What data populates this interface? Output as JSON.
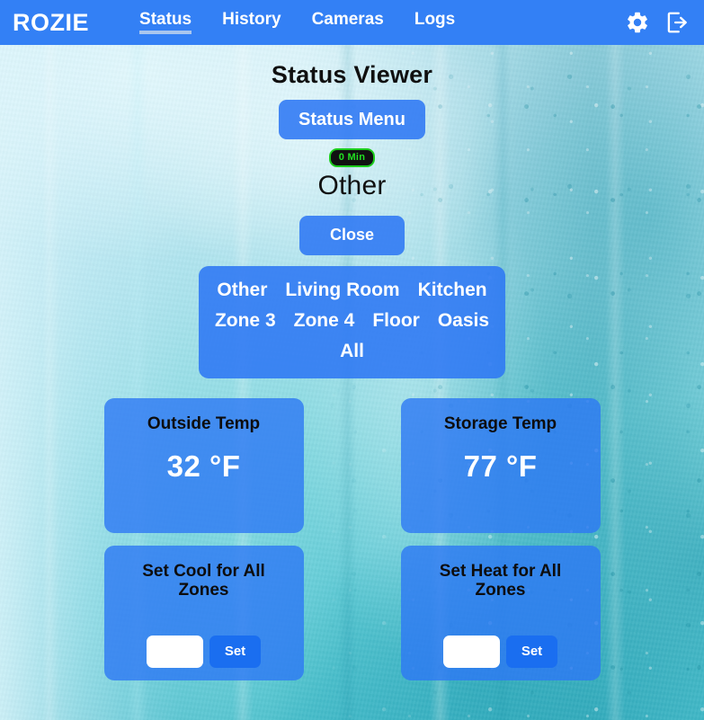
{
  "app": {
    "brand": "ROZIE",
    "header_color": "#3380f5",
    "accent_color": "#2d78f4",
    "active_tab_underline": "#a9c6ee"
  },
  "nav": {
    "links": [
      {
        "label": "Status",
        "active": true
      },
      {
        "label": "History",
        "active": false
      },
      {
        "label": "Cameras",
        "active": false
      },
      {
        "label": "Logs",
        "active": false
      }
    ],
    "actions": [
      {
        "icon": "gear-icon",
        "label": "Settings"
      },
      {
        "icon": "sign-out-icon",
        "label": "Log Out"
      }
    ]
  },
  "main": {
    "page_title": "Status Viewer",
    "status_menu_label": "Status Menu",
    "badge": {
      "text": "0 Min",
      "text_color": "#22e022",
      "background_color": "#111111"
    },
    "selected_zone": "Other",
    "close_label": "Close",
    "zones": [
      "Other",
      "Living Room",
      "Kitchen",
      "Zone 3",
      "Zone 4",
      "Floor",
      "Oasis",
      "All"
    ]
  },
  "cards": [
    {
      "name": "outside-temp",
      "title": "Outside Temp",
      "value": "32 °F"
    },
    {
      "name": "storage-temp",
      "title": "Storage Temp",
      "value": "77 °F"
    }
  ],
  "setters": [
    {
      "name": "set-cool-all-zones",
      "title": "Set Cool for All Zones",
      "input_value": "",
      "input_placeholder": "",
      "button_label": "Set"
    },
    {
      "name": "set-heat-all-zones",
      "title": "Set Heat for All Zones",
      "input_value": "",
      "input_placeholder": "",
      "button_label": "Set"
    }
  ]
}
